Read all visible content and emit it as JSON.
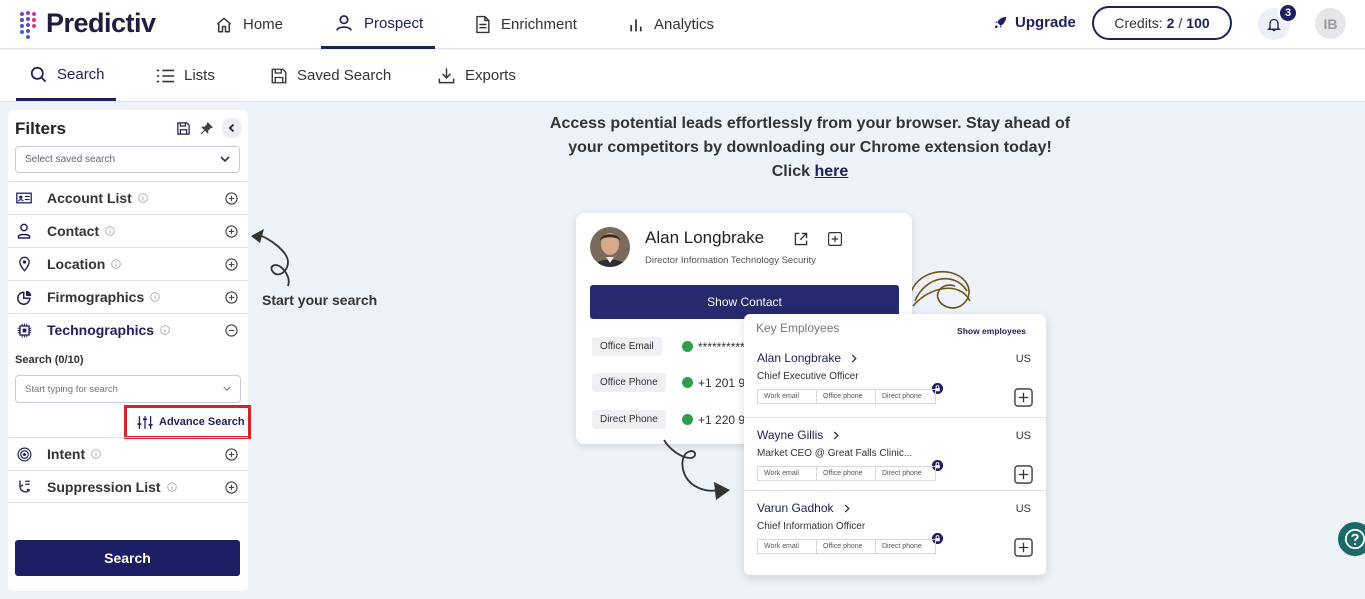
{
  "app": {
    "logo_text": "Predictiv"
  },
  "topnav": {
    "items": [
      {
        "label": "Home"
      },
      {
        "label": "Prospect"
      },
      {
        "label": "Enrichment"
      },
      {
        "label": "Analytics"
      }
    ],
    "upgrade_label": "Upgrade",
    "credits_label": "Credits:",
    "credits_used": "2",
    "credits_sep": "/",
    "credits_total": "100",
    "notification_count": "3",
    "user_initials": "IB"
  },
  "subnav": {
    "items": [
      {
        "label": "Search"
      },
      {
        "label": "Lists"
      },
      {
        "label": "Saved Search"
      },
      {
        "label": "Exports"
      }
    ]
  },
  "filters": {
    "title": "Filters",
    "saved_search_placeholder": "Select saved search",
    "items": [
      {
        "label": "Account List"
      },
      {
        "label": "Contact"
      },
      {
        "label": "Location"
      },
      {
        "label": "Firmographics"
      },
      {
        "label": "Technographics"
      },
      {
        "label": "Intent"
      },
      {
        "label": "Suppression List"
      }
    ],
    "tech_search_label": "Search (0/10)",
    "tech_search_placeholder": "Start typing for search",
    "advance_search_label": "Advance Search",
    "search_button": "Search"
  },
  "hero": {
    "line1": "Access potential leads effortlessly from your browser. Stay ahead of",
    "line2": "your competitors by downloading our Chrome extension today!",
    "click_text": "Click",
    "link_text": "here"
  },
  "start_hint": "Start your search",
  "contact_card": {
    "name": "Alan Longbrake",
    "title": "Director Information Technology Security",
    "show_contact": "Show Contact",
    "rows": [
      {
        "label": "Office Email",
        "value": "**********"
      },
      {
        "label": "Office Phone",
        "value": "+1 201 9"
      },
      {
        "label": "Direct Phone",
        "value": "+1 220 9"
      }
    ]
  },
  "key_employees": {
    "title": "Key Employees",
    "show_label": "Show employees",
    "tag_labels": [
      "Work email",
      "Office phone",
      "Direct phone"
    ],
    "employees": [
      {
        "name": "Alan Longbrake",
        "role": "Chief Executive Officer",
        "country": "US"
      },
      {
        "name": "Wayne Gillis",
        "role": "Market CEO @ Great Falls Clinic...",
        "country": "US"
      },
      {
        "name": "Varun Gadhok",
        "role": "Chief Information Officer",
        "country": "US"
      }
    ]
  },
  "colors": {
    "brand": "#1e1f5e",
    "highlight": "#d9212a",
    "success": "#2e9d4c",
    "help": "#1b6a6a"
  }
}
